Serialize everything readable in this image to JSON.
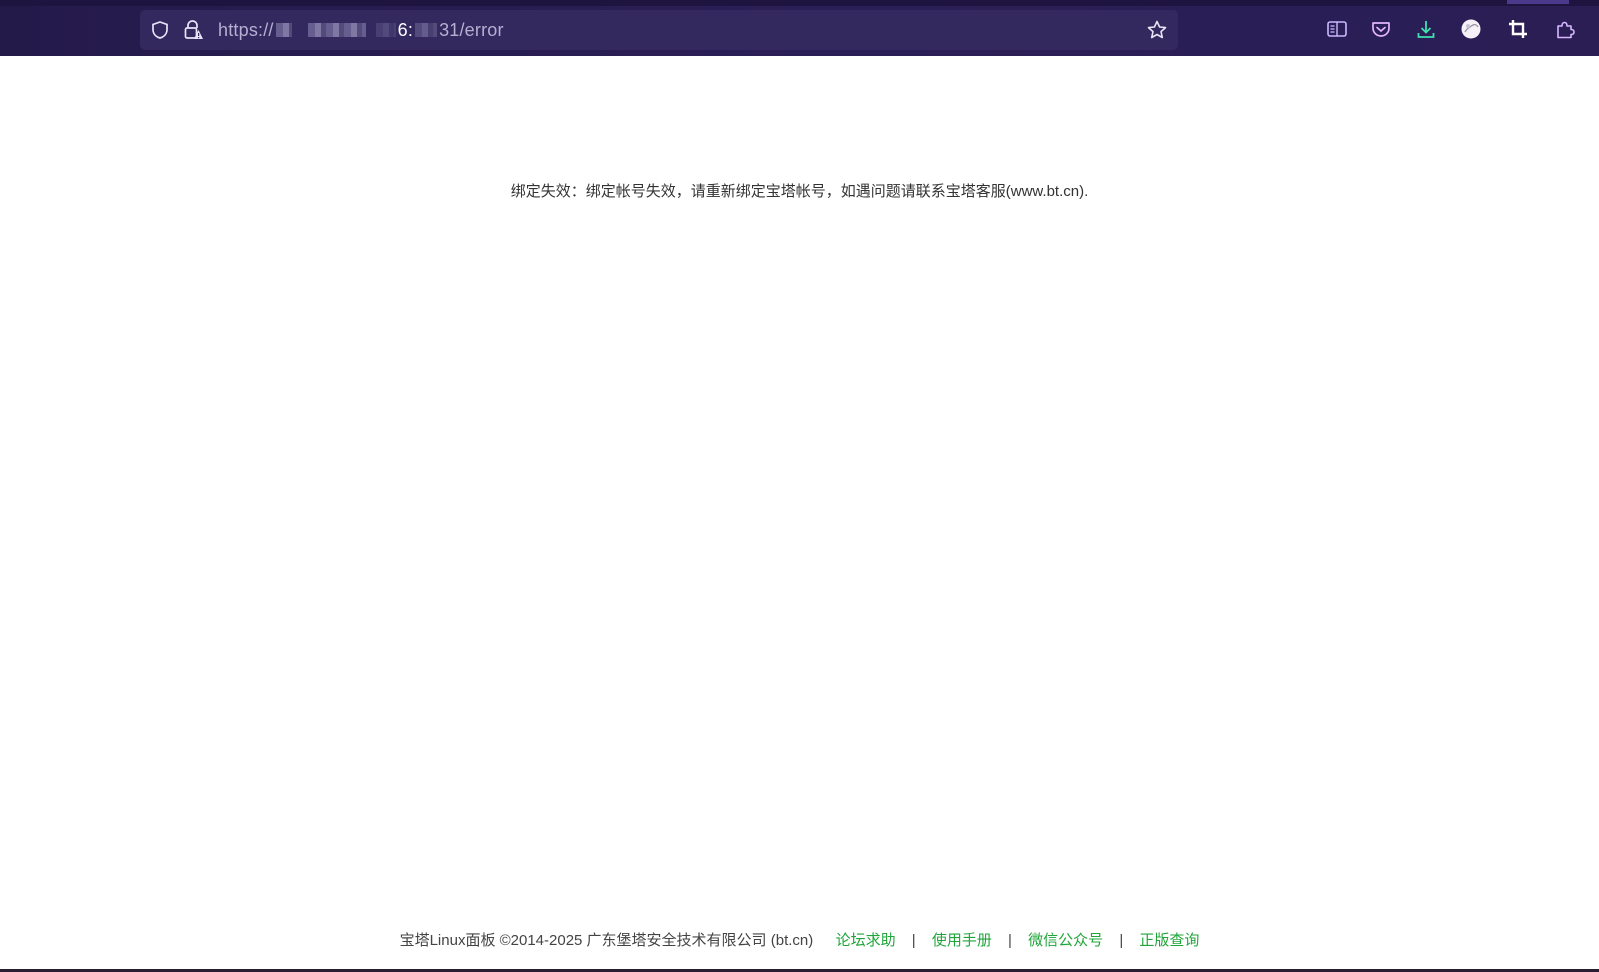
{
  "browser": {
    "url_prefix": "https://",
    "url_middle": "6:",
    "url_suffix": "31/error"
  },
  "page": {
    "message": "绑定失效：绑定帐号失效，请重新绑定宝塔帐号，如遇问题请联系宝塔客服(www.bt.cn).",
    "footer": {
      "copyright": "宝塔Linux面板 ©2014-2025 广东堡塔安全技术有限公司 (bt.cn)",
      "links": [
        "论坛求助",
        "使用手册",
        "微信公众号",
        "正版查询"
      ],
      "separator": "|"
    }
  },
  "colors": {
    "toolbar_bg": "#2a1e55",
    "urlbar_bg": "#33295f",
    "link_green": "#20a53a",
    "download_icon": "#3fe1b0"
  },
  "icons": {
    "urlbar": [
      "shield-icon",
      "lock-warning-icon",
      "bookmark-star-icon"
    ],
    "toolbar": [
      "reader-view-icon",
      "pocket-icon",
      "download-icon",
      "profile-avatar-icon",
      "crop-screenshot-icon",
      "extensions-icon"
    ]
  }
}
